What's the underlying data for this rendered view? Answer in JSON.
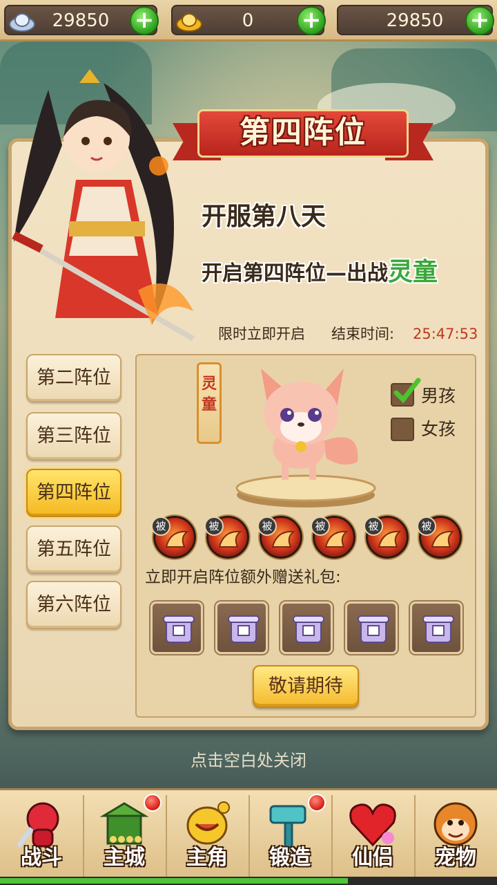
{
  "currency": {
    "silver": "29850",
    "gold": "0",
    "third": "29850",
    "silver_icon": "silver-ingot-icon",
    "gold_icon": "gold-ingot-icon"
  },
  "banner": {
    "title": "第四阵位",
    "line1": "开服第八天",
    "line2_prefix": "开启第四阵位—出战",
    "line2_highlight": "灵童",
    "limit_text": "限时立即开启",
    "end_label": "结束时间:",
    "countdown": "25:47:53"
  },
  "tabs": [
    {
      "label": "第二阵位",
      "active": false
    },
    {
      "label": "第三阵位",
      "active": false
    },
    {
      "label": "第四阵位",
      "active": true
    },
    {
      "label": "第五阵位",
      "active": false
    },
    {
      "label": "第六阵位",
      "active": false
    }
  ],
  "pet": {
    "tag": "灵童",
    "options": [
      {
        "label": "男孩",
        "checked": true
      },
      {
        "label": "女孩",
        "checked": false
      }
    ],
    "skill_badge": "被"
  },
  "gift": {
    "label": "立即开启阵位额外赠送礼包:",
    "button": "敬请期待"
  },
  "close_hint": "点击空白处关闭",
  "nav": [
    {
      "label": "战斗",
      "icon": "battle-icon",
      "dot": false
    },
    {
      "label": "主城",
      "icon": "city-icon",
      "dot": true
    },
    {
      "label": "主角",
      "icon": "hero-icon",
      "dot": false
    },
    {
      "label": "锻造",
      "icon": "forge-hammer-icon",
      "dot": true
    },
    {
      "label": "仙侣",
      "icon": "heart-icon",
      "dot": false
    },
    {
      "label": "宠物",
      "icon": "monkey-pet-icon",
      "dot": false
    }
  ],
  "progress": 0.7,
  "colors": {
    "countdown": "#c2371d",
    "highlight": "#3aa83a",
    "active_tab": "#f4b81f"
  }
}
